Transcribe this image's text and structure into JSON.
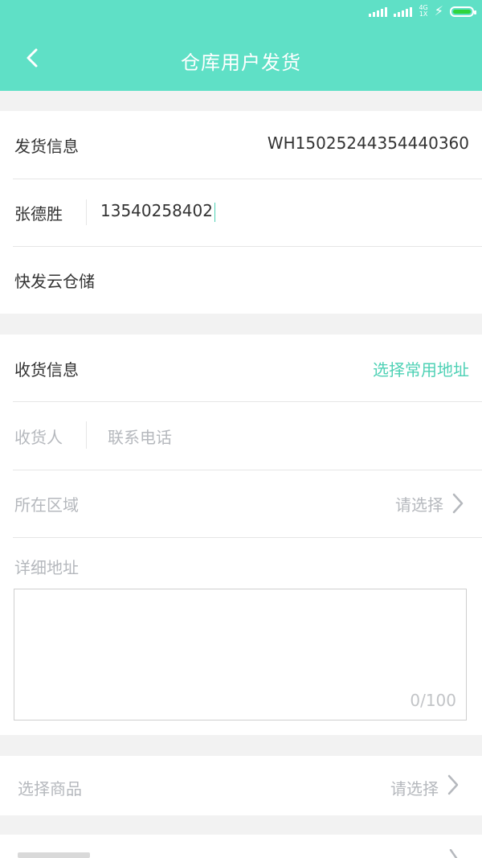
{
  "header": {
    "title": "仓库用户发货"
  },
  "status_bar": {
    "net_top": "4G",
    "net_bottom": "1X"
  },
  "sender": {
    "section_label": "发货信息",
    "order_no": "WH15025244354440360",
    "name": "张德胜",
    "phone": "13540258402",
    "warehouse": "快发云仓储"
  },
  "receiver": {
    "section_label": "收货信息",
    "choose_address": "选择常用地址",
    "name_placeholder": "收货人",
    "phone_placeholder": "联系电话",
    "region_label": "所在区域",
    "region_value": "请选择",
    "address_label": "详细地址",
    "address_value": "",
    "address_counter": "0/100"
  },
  "goods": {
    "label": "选择商品",
    "value": "请选择"
  }
}
